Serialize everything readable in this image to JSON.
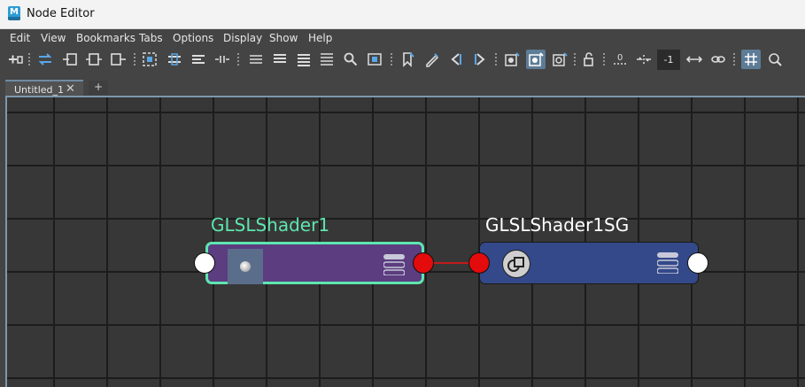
{
  "window": {
    "title": "Node Editor",
    "app_icon_letter": "M"
  },
  "menu": [
    "Edit",
    "View",
    "Bookmarks",
    "Tabs",
    "Options",
    "Display",
    "Show",
    "Help"
  ],
  "toolbar": {
    "icons": [
      "add-to-graph-icon",
      "swap-icon",
      "input-connections-icon",
      "input-output-icon",
      "output-connections-icon",
      "frame-all-icon",
      "frame-selected-icon",
      "layout-icon",
      "spread-icon",
      "simple-mode-icon",
      "connected-mode-icon",
      "full-mode-icon",
      "custom-mode-icon",
      "search-icon",
      "snapshot-icon",
      "bookmark-icon",
      "bookmark-edit-icon",
      "prev-bookmark-icon",
      "next-bookmark-icon",
      "render-swatch-icon",
      "graph-swatch-icon",
      "swatch-toggle-icon",
      "lock-icon",
      "zero-icon",
      "collapse-icon",
      "expand-icon",
      "link-icon",
      "grid-icon",
      "snap-icon"
    ],
    "field_value": "-1"
  },
  "tabs": [
    {
      "label": "Untitled_1",
      "close": "✕"
    }
  ],
  "tab_add": "+",
  "colors": {
    "selected_outline": "#5ee6ae",
    "shader_node": "#5b3d80",
    "sg_node": "#33498a",
    "connection": "#c21a1a",
    "connected_port": "#e30b0b"
  },
  "nodes": [
    {
      "title": "GLSLShader1",
      "title_color": "#5ee6ae",
      "selected": true
    },
    {
      "title": "GLSLShader1SG",
      "title_color": "#ffffff",
      "selected": false
    }
  ]
}
